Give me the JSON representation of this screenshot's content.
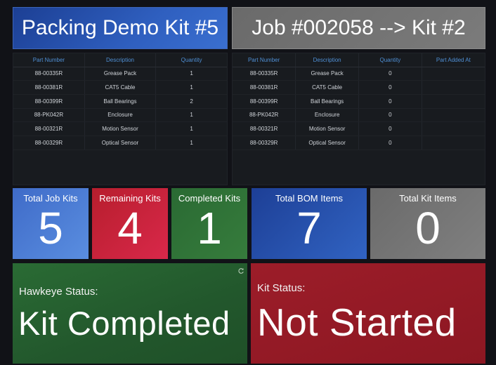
{
  "header": {
    "left_title": "Packing Demo Kit #5",
    "right_title": "Job #002058 --> Kit #2"
  },
  "bom_table": {
    "columns": [
      "Part Number",
      "Description",
      "Quantity"
    ],
    "rows": [
      [
        "88-00335R",
        "Grease Pack",
        "1"
      ],
      [
        "88-00381R",
        "CAT5 Cable",
        "1"
      ],
      [
        "88-00399R",
        "Ball Bearings",
        "2"
      ],
      [
        "88-PK042R",
        "Enclosure",
        "1"
      ],
      [
        "88-00321R",
        "Motion Sensor",
        "1"
      ],
      [
        "88-00329R",
        "Optical Sensor",
        "1"
      ]
    ]
  },
  "kit_table": {
    "columns": [
      "Part Number",
      "Description",
      "Quantity",
      "Part Added At"
    ],
    "rows": [
      [
        "88-00335R",
        "Grease Pack",
        "0",
        ""
      ],
      [
        "88-00381R",
        "CAT5 Cable",
        "0",
        ""
      ],
      [
        "88-00399R",
        "Ball Bearings",
        "0",
        ""
      ],
      [
        "88-PK042R",
        "Enclosure",
        "0",
        ""
      ],
      [
        "88-00321R",
        "Motion Sensor",
        "0",
        ""
      ],
      [
        "88-00329R",
        "Optical Sensor",
        "0",
        ""
      ]
    ]
  },
  "stats": {
    "total_job_kits": {
      "label": "Total Job Kits",
      "value": "5"
    },
    "remaining_kits": {
      "label": "Remaining Kits",
      "value": "4"
    },
    "completed_kits": {
      "label": "Completed Kits",
      "value": "1"
    },
    "total_bom_items": {
      "label": "Total BOM Items",
      "value": "7"
    },
    "total_kit_items": {
      "label": "Total Kit Items",
      "value": "0"
    }
  },
  "status": {
    "hawkeye": {
      "label": "Hawkeye Status:",
      "value": "Kit Completed"
    },
    "kit": {
      "label": "Kit Status:",
      "value": "Not Started"
    }
  },
  "icons": {
    "refresh": "refresh-icon"
  },
  "colors": {
    "blue_accent": "#2f5fbf",
    "gray_panel": "#7b7b7b",
    "red_status": "#9c1d29",
    "green_status": "#2a6b34",
    "table_header_text": "#4f8fd4"
  }
}
